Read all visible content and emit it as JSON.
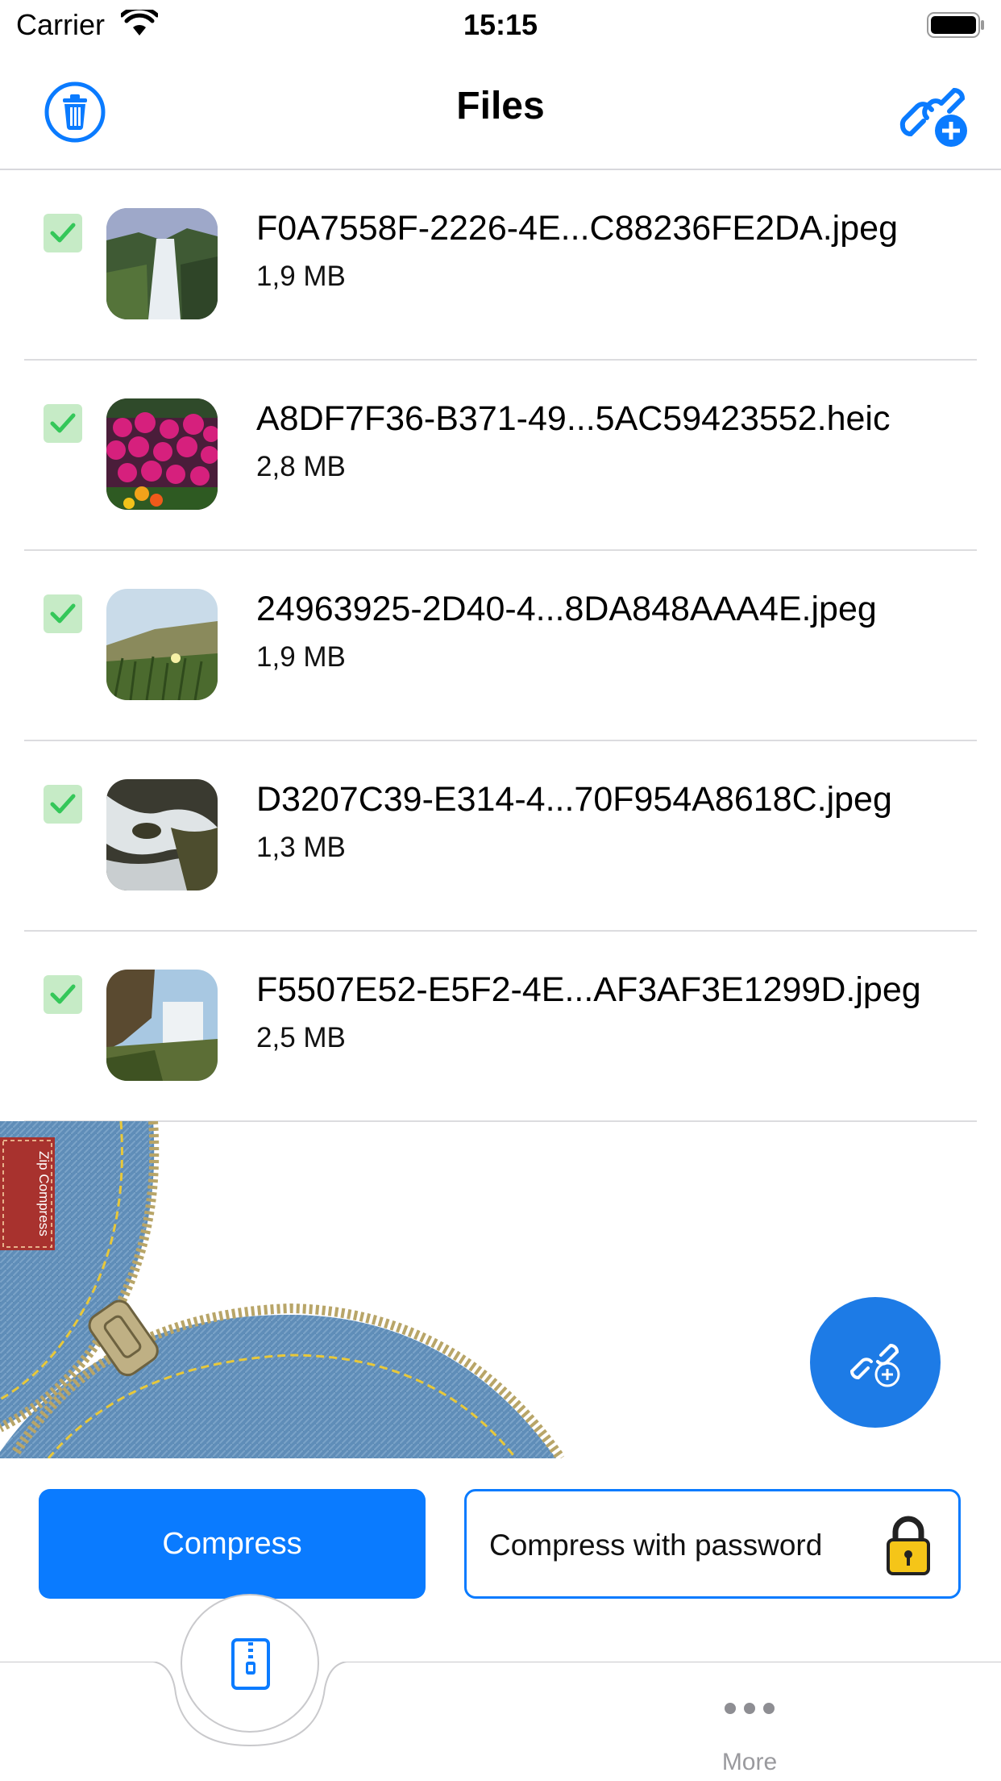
{
  "status_bar": {
    "carrier": "Carrier",
    "time": "15:15"
  },
  "nav": {
    "title": "Files"
  },
  "files": [
    {
      "name": "F0A7558F-2226-4E...C88236FE2DA.jpeg",
      "size": "1,9 MB",
      "checked": true
    },
    {
      "name": "A8DF7F36-B371-49...5AC59423552.heic",
      "size": "2,8 MB",
      "checked": true
    },
    {
      "name": "24963925-2D40-4...8DA848AAA4E.jpeg",
      "size": "1,9 MB",
      "checked": true
    },
    {
      "name": "D3207C39-E314-4...70F954A8618C.jpeg",
      "size": "1,3 MB",
      "checked": true
    },
    {
      "name": "F5507E52-E5F2-4E...AF3AF3E1299D.jpeg",
      "size": "2,5 MB",
      "checked": true
    }
  ],
  "banner": {
    "tag_text": "Zip Compress"
  },
  "buttons": {
    "compress": "Compress",
    "compress_password": "Compress with password"
  },
  "tab_bar": {
    "more_label": "More"
  },
  "colors": {
    "accent": "#0a7bff",
    "fab": "#1d7be6",
    "check_bg": "#c6ebc6",
    "check_mark": "#34c759"
  }
}
